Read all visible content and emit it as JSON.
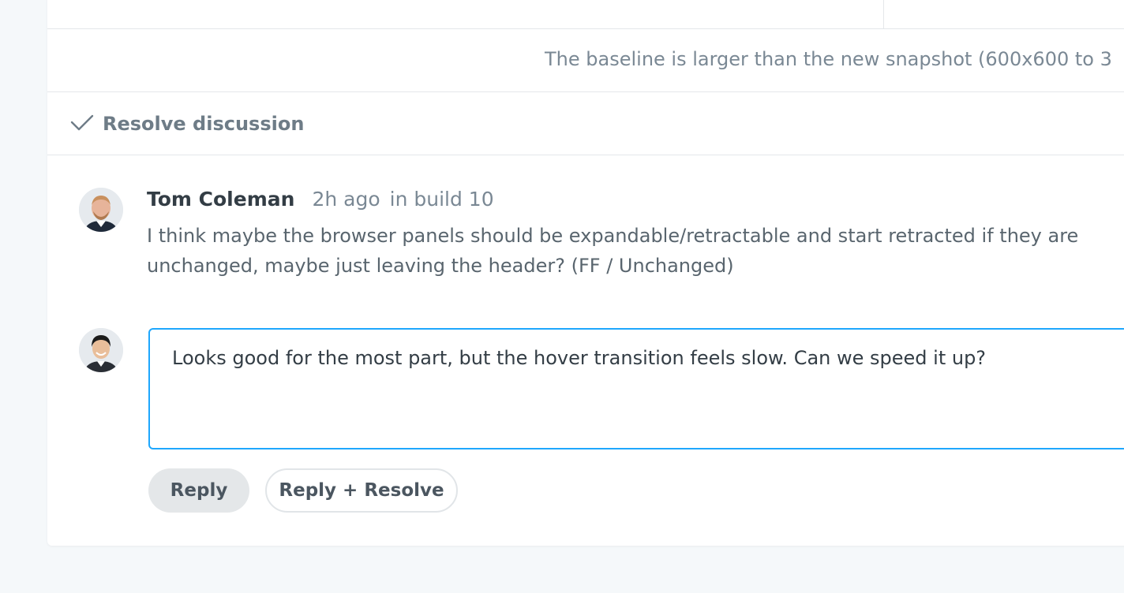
{
  "info": {
    "message": "The baseline is larger than the new snapshot (600x600 to 3"
  },
  "discussion": {
    "resolve_label": "Resolve discussion",
    "comment": {
      "author": "Tom Coleman",
      "time": "2h ago",
      "build": "in build 10",
      "body": "I think maybe the browser panels should be expandable/retractable and start retracted if they are unchanged, maybe just leaving the header? (FF / Unchanged)"
    },
    "reply": {
      "text": "Looks good for the most part, but the hover transition feels slow. Can we speed it up?",
      "reply_label": "Reply",
      "reply_resolve_label": "Reply + Resolve"
    }
  },
  "colors": {
    "accent": "#1ea7fd",
    "background": "#f5f8fa",
    "muted_text": "#7a8894"
  }
}
